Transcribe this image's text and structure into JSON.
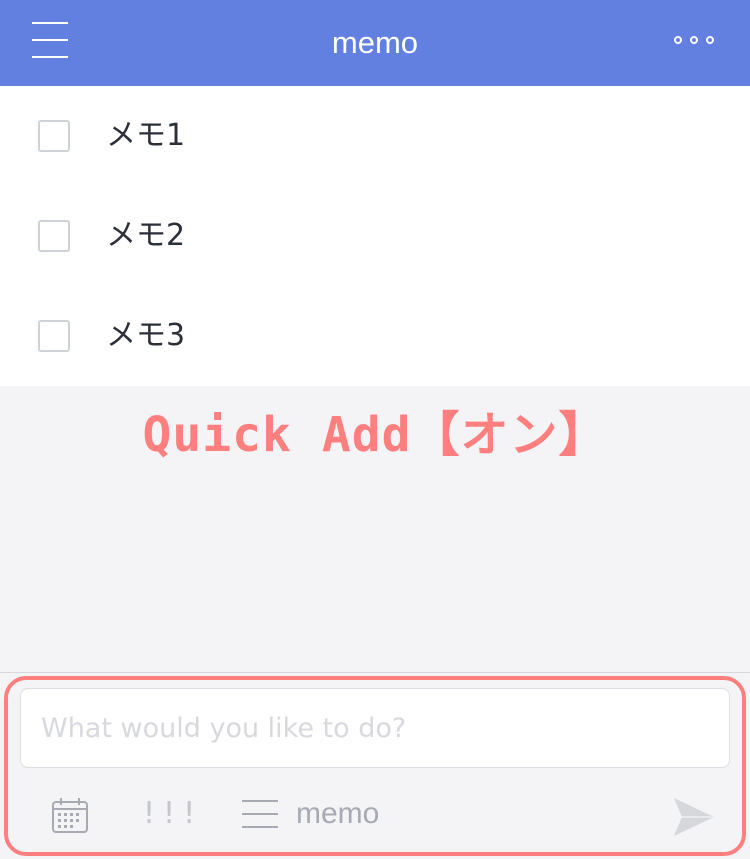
{
  "header": {
    "title": "memo",
    "bg_color": "#6180df",
    "menu_icon": "hamburger-menu-icon",
    "more_icon": "more-options-icon"
  },
  "todos": [
    {
      "text": "メモ1",
      "checked": false
    },
    {
      "text": "メモ2",
      "checked": false
    },
    {
      "text": "メモ3",
      "checked": false
    }
  ],
  "annotation": {
    "text": "Quick Add【オン】",
    "color": "#ff7f7f"
  },
  "quick_add": {
    "placeholder": "What would you like to do?",
    "priority_label": "!!!",
    "project_label": "memo",
    "calendar_icon": "calendar-icon",
    "project_icon": "list-lines-icon",
    "send_icon": "send-icon",
    "highlight_color": "#ff7f7f"
  }
}
